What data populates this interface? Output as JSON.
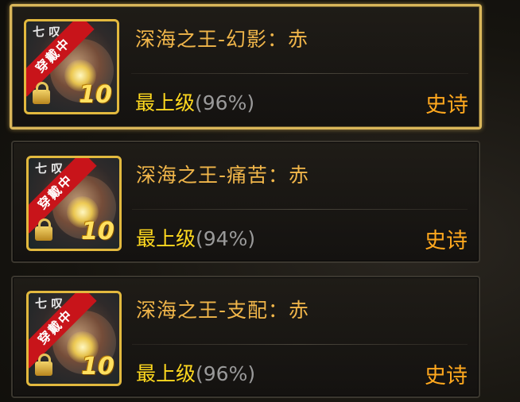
{
  "items": [
    {
      "name": "深海之王-幻影：赤",
      "grade_label": "最上级",
      "grade_percent": "(96%)",
      "rarity": "史诗",
      "ribbon": "穿戴中",
      "level": "10",
      "corner_mark": "七 叹",
      "locked": true,
      "selected": true
    },
    {
      "name": "深海之王-痛苦：赤",
      "grade_label": "最上级",
      "grade_percent": "(94%)",
      "rarity": "史诗",
      "ribbon": "穿戴中",
      "level": "10",
      "corner_mark": "七 叹",
      "locked": true,
      "selected": false
    },
    {
      "name": "深海之王-支配：赤",
      "grade_label": "最上级",
      "grade_percent": "(96%)",
      "rarity": "史诗",
      "ribbon": "穿戴中",
      "level": "10",
      "corner_mark": "七 叹",
      "locked": true,
      "selected": false
    }
  ],
  "colors": {
    "name": "#f1b64a",
    "grade_label": "#ffd91f",
    "grade_percent": "#9a9a9a",
    "rarity": "#ffa81e",
    "selected_border": "#d9b65a",
    "ribbon": "#c8141a"
  },
  "icons": {
    "lock": "lock-icon",
    "equipped": "equipped-ribbon"
  }
}
